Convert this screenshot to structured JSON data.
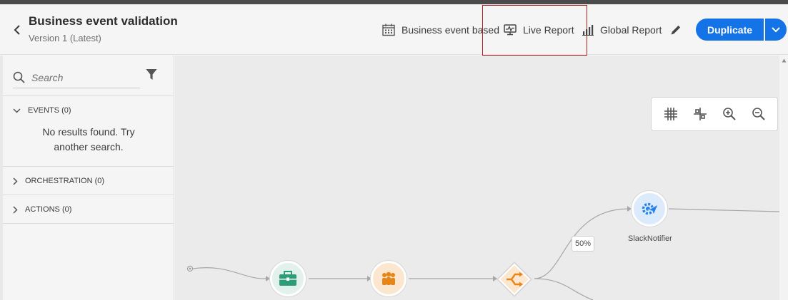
{
  "header": {
    "title": "Business event validation",
    "version": "Version 1 (Latest)",
    "buttons": {
      "event_based": "Business event based",
      "live_report": "Live Report",
      "global_report": "Global Report",
      "duplicate": "Duplicate"
    }
  },
  "sidebar": {
    "search": {
      "placeholder": "Search",
      "value": ""
    },
    "sections": [
      {
        "label": "EVENTS (0)",
        "expanded": true,
        "empty_message": "No results found. Try another search."
      },
      {
        "label": "ORCHESTRATION (0)",
        "expanded": false
      },
      {
        "label": "ACTIONS (0)",
        "expanded": false
      }
    ]
  },
  "canvas": {
    "toolbar_icons": [
      "grid-icon",
      "arrange-icon",
      "zoom-in-icon",
      "zoom-out-icon"
    ],
    "nodes": [
      {
        "type": "start",
        "icon": "start-dot-icon"
      },
      {
        "type": "business-event",
        "icon": "briefcase-icon"
      },
      {
        "type": "audience",
        "icon": "people-icon"
      },
      {
        "type": "split",
        "icon": "split-icon"
      },
      {
        "type": "slack-action",
        "icon": "gear-plane-icon",
        "label": "SlackNotifier"
      }
    ],
    "split_percentage": "50%"
  },
  "colors": {
    "accent": "#1473e6",
    "highlight": "#b21e1e",
    "event_node": "#2d9d78",
    "audience_node": "#e68619",
    "action_node": "#2680eb"
  }
}
